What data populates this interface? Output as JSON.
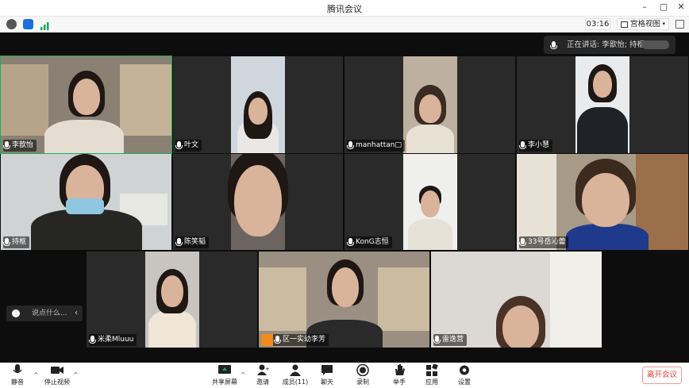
{
  "app": {
    "title": "腾讯会议"
  },
  "toolbar": {
    "timer": "03:16",
    "view_label": "宫格视图"
  },
  "speaking": {
    "text": "正在讲话: 李歆怡; 持枢;"
  },
  "participants": [
    {
      "name": "李歆怡"
    },
    {
      "name": "叶文"
    },
    {
      "name": "manhattan□"
    },
    {
      "name": "李小慧"
    },
    {
      "name": "持枢"
    },
    {
      "name": "陈笑韬"
    },
    {
      "name": "KonG志恒"
    },
    {
      "name": "33号岳沁蕾"
    },
    {
      "name": "米柔Mluuu"
    },
    {
      "name": "区一实幼李芳"
    },
    {
      "name": "雷逸营"
    }
  ],
  "chat": {
    "placeholder": "说点什么..."
  },
  "bottom": {
    "mute": "静音",
    "stop_video": "停止视频",
    "share": "共享屏幕",
    "invite": "邀请",
    "members": "成员(11)",
    "chat": "聊天",
    "record": "录制",
    "raise_hand": "举手",
    "apps": "应用",
    "settings": "设置",
    "leave": "离开会议"
  },
  "colors": {
    "active_border": "#1aad57",
    "leave_text": "#e0413a",
    "background": "#0d0d0d"
  }
}
